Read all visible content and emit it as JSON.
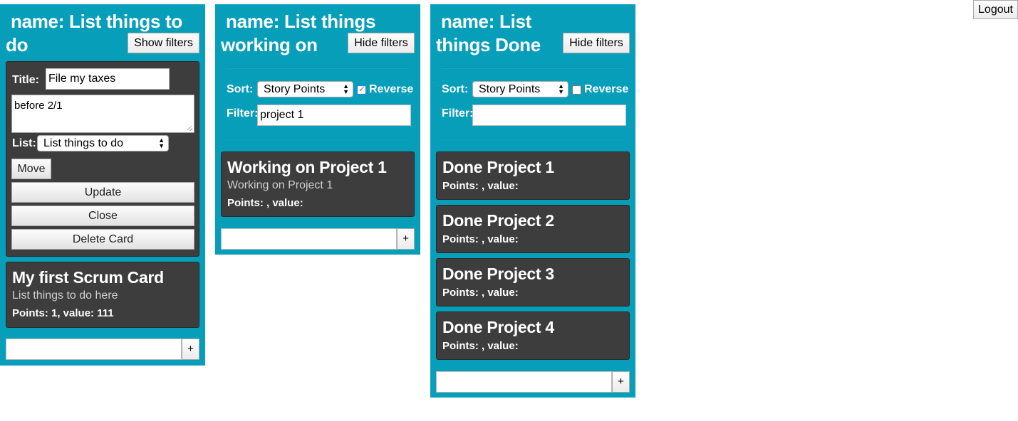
{
  "logout_label": "Logout",
  "columns": [
    {
      "title": "name: List things to do",
      "filter_toggle": "Show filters",
      "editor": {
        "title_label": "Title:",
        "title_value": "File my taxes",
        "description_value": "before 2/1",
        "list_label": "List:",
        "list_value": "List things to do",
        "move_label": "Move",
        "update_label": "Update",
        "close_label": "Close",
        "delete_label": "Delete Card"
      },
      "cards": [
        {
          "title": "My first Scrum Card",
          "description": "List things to do here",
          "points": "Points: 1, value: 111"
        }
      ],
      "add_label": "+"
    },
    {
      "title": "name: List things working on",
      "filter_toggle": "Hide filters",
      "sort_label": "Sort:",
      "sort_value": "Story Points",
      "reverse_label": "Reverse",
      "reverse_checked": true,
      "filter_label": "Filter:",
      "filter_value": "project 1",
      "cards": [
        {
          "title": "Working on Project 1",
          "description": "Working on Project 1",
          "points": "Points: , value:"
        }
      ],
      "add_label": "+"
    },
    {
      "title": "name: List things Done",
      "filter_toggle": "Hide filters",
      "sort_label": "Sort:",
      "sort_value": "Story Points",
      "reverse_label": "Reverse",
      "reverse_checked": false,
      "filter_label": "Filter:",
      "filter_value": "",
      "cards": [
        {
          "title": "Done Project 1",
          "points": "Points: , value:"
        },
        {
          "title": "Done Project 2",
          "points": "Points: , value:"
        },
        {
          "title": "Done Project 3",
          "points": "Points: , value:"
        },
        {
          "title": "Done Project 4",
          "points": "Points: , value:"
        }
      ],
      "add_label": "+"
    }
  ],
  "colors": {
    "column_bg": "#079eba",
    "card_bg": "#3d3d3d"
  }
}
